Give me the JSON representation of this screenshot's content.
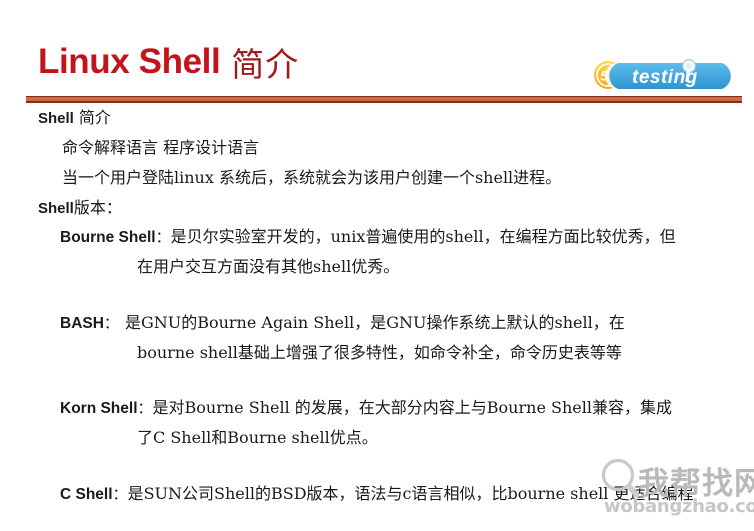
{
  "slide": {
    "title_latin": "Linux Shell",
    "title_cjk": "简介",
    "background_color": "#ffffff",
    "title_color": "#C2151B",
    "divider_color_dark": "#8C2B10",
    "divider_color_light": "#C8703F"
  },
  "logo": {
    "name": "51testing-logo",
    "badge_text": "51",
    "word": "testing",
    "pill_color": "#3FA9E0",
    "badge_color": "#F5C518",
    "badge_text_color": "#ffffff",
    "word_color": "#ffffff"
  },
  "body": {
    "heading": {
      "lead": "Shell",
      "cjk": "简介"
    },
    "sub_lines": [
      "命令解释语言        程序设计语言",
      "当一个用户登陆linux 系统后，系统就会为该用户创建一个shell进程。"
    ],
    "versions_heading": {
      "lead": "Shell",
      "cjk": "版本："
    },
    "entries": [
      {
        "name": "Bourne Shell",
        "colon": "：",
        "lines": [
          "是贝尔实验室开发的，unix普遍使用的shell，在编程方面比较优秀，但",
          "在用户交互方面没有其他shell优秀。"
        ]
      },
      {
        "name": "BASH",
        "colon": "：",
        "lines": [
          "是GNU的Bourne Again Shell，是GNU操作系统上默认的shell，在",
          "bourne shell基础上增强了很多特性，如命令补全，命令历史表等等"
        ]
      },
      {
        "name": "Korn Shell",
        "colon": "：",
        "lines": [
          "是对Bourne Shell 的发展，在大部分内容上与Bourne Shell兼容，集成",
          "了C Shell和Bourne shell优点。"
        ]
      },
      {
        "name": "C Shell",
        "colon": "：",
        "lines": [
          "是SUN公司Shell的BSD版本，语法与c语言相似，比bourne shell 更适合编程"
        ]
      }
    ]
  },
  "watermark": {
    "cjk": "我帮找网",
    "url": "wobangzhao.com",
    "color": "#bcbcbc"
  }
}
